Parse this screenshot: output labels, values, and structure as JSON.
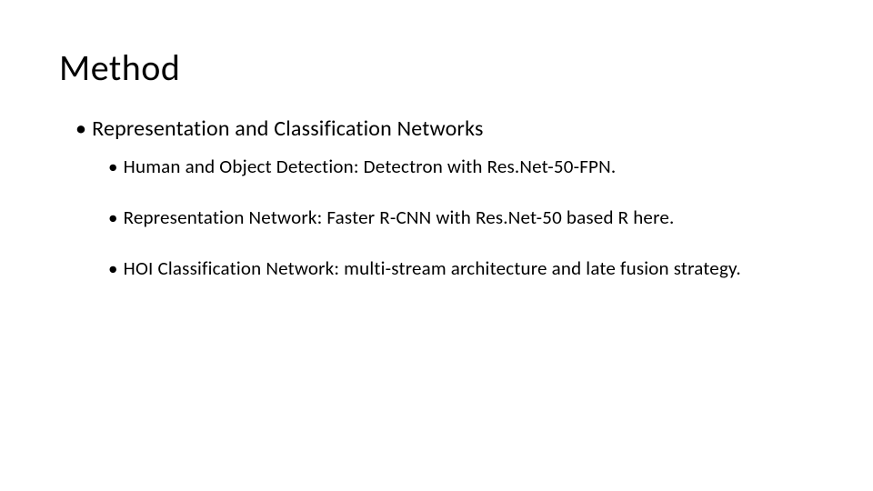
{
  "slide": {
    "title": "Method",
    "level1": "Representation and Classification Networks",
    "sub_items": [
      "Human and Object Detection: Detectron with Res.Net-50-FPN.",
      "Representation Network: Faster R-CNN with Res.Net-50 based R here.",
      "HOI Classification Network: multi-stream architecture and late fusion strategy."
    ],
    "bullet": "•"
  }
}
